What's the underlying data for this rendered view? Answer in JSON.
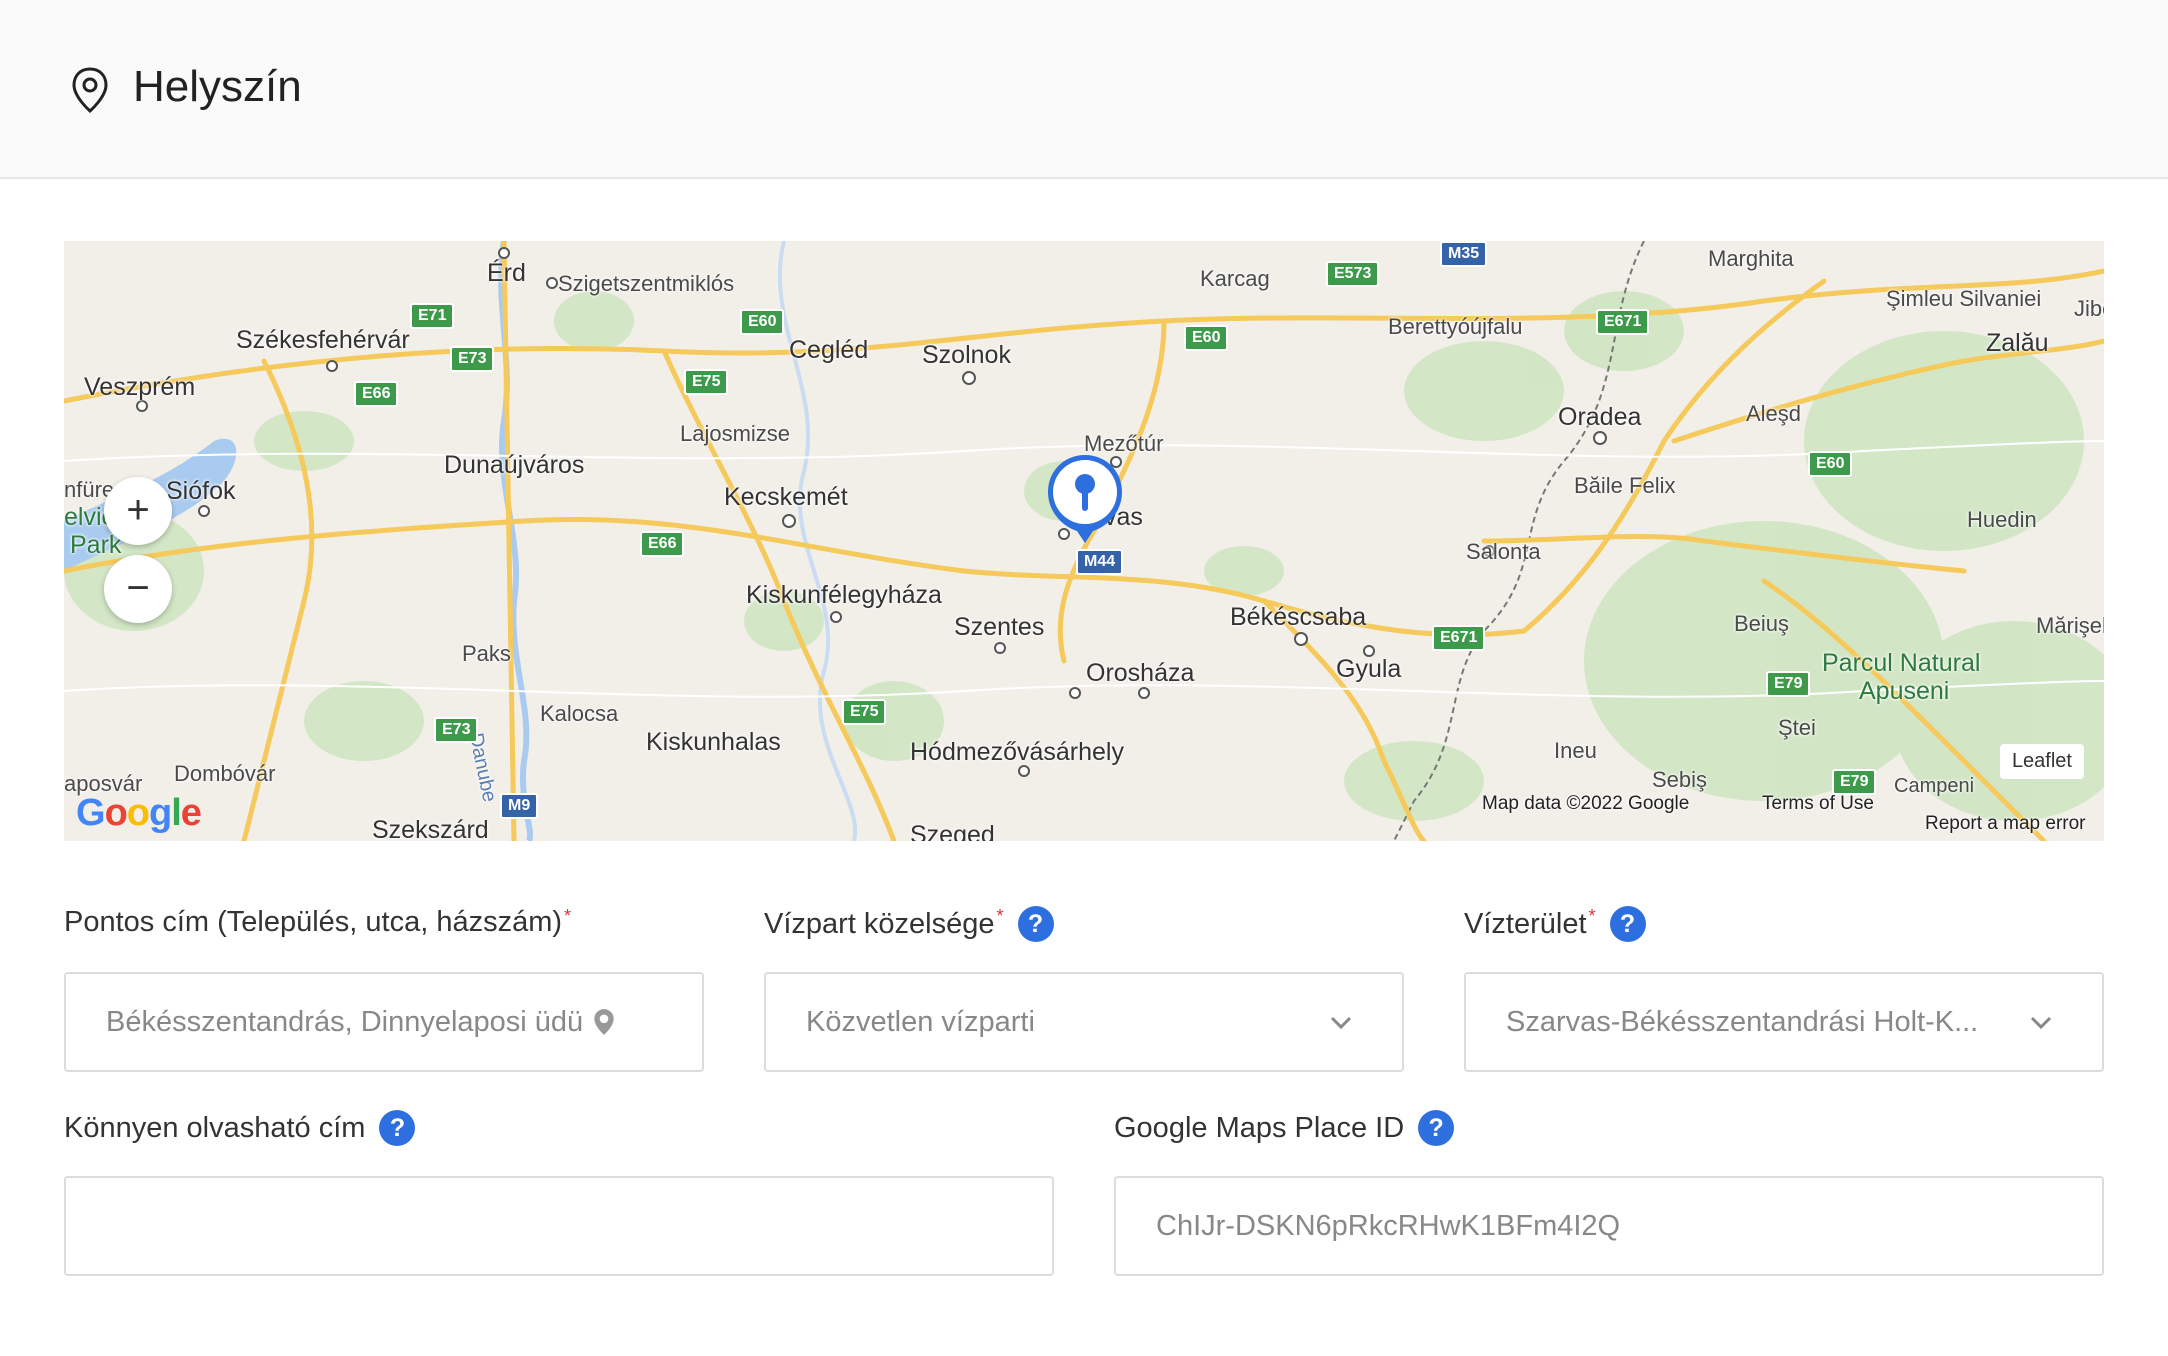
{
  "header": {
    "title": "Helyszín",
    "icon": "map-pin-icon"
  },
  "map": {
    "cities": [
      {
        "name": "Érd"
      },
      {
        "name": "Szigetszentmiklós"
      },
      {
        "name": "Karcag"
      },
      {
        "name": "Marghita"
      },
      {
        "name": "Székesfehérvár"
      },
      {
        "name": "Cegléd"
      },
      {
        "name": "Szolnok"
      },
      {
        "name": "Berettyóújfalu"
      },
      {
        "name": "Şimleu Silvaniei"
      },
      {
        "name": "Zalău"
      },
      {
        "name": "Jibo"
      },
      {
        "name": "Veszprém"
      },
      {
        "name": "Oradea"
      },
      {
        "name": "Aleşd"
      },
      {
        "name": "Lajosmizse"
      },
      {
        "name": "Mezőtúr"
      },
      {
        "name": "Dunaújváros"
      },
      {
        "name": "Băile Felix"
      },
      {
        "name": "Siófok"
      },
      {
        "name": "Kecskemét"
      },
      {
        "name": "Huedin"
      },
      {
        "name": "Salonta"
      },
      {
        "name": "Kiskunfélegyháza"
      },
      {
        "name": "Békéscsaba"
      },
      {
        "name": "Beiuş"
      },
      {
        "name": "Mărişel"
      },
      {
        "name": "Szentes"
      },
      {
        "name": "Paks"
      },
      {
        "name": "Gyula"
      },
      {
        "name": "Orosháza"
      },
      {
        "name": "Kalocsa"
      },
      {
        "name": "Kiskunhalas"
      },
      {
        "name": "Ştei"
      },
      {
        "name": "Hódmezővásárhely"
      },
      {
        "name": "Ineu"
      },
      {
        "name": "Sebiş"
      },
      {
        "name": "Dombóvár"
      },
      {
        "name": "aposvár"
      },
      {
        "name": "Campeni"
      },
      {
        "name": "Szekszárd"
      },
      {
        "name": "Szeged"
      },
      {
        "name": "nfüre"
      },
      {
        "name": "elvic"
      },
      {
        "name": "Park"
      },
      {
        "name": "vas"
      }
    ],
    "park_label_1": "Parcul Natural",
    "park_label_2": "Apuseni",
    "river_label": "Danube",
    "roads": [
      "E71",
      "E73",
      "E66",
      "E60",
      "E75",
      "E573",
      "M35",
      "E60",
      "E671",
      "E66",
      "E60",
      "E671",
      "E79",
      "E75",
      "E73",
      "M9",
      "E79",
      "M44"
    ],
    "zoom_in": "+",
    "zoom_out": "−",
    "attribution": "Map data ©2022 Google",
    "terms": "Terms of Use",
    "report": "Report a map error",
    "leaflet": "Leaflet",
    "google": "Google"
  },
  "form": {
    "address": {
      "label": "Pontos cím (Település, utca, házszám)",
      "required": "*",
      "value": "Békésszentandrás, Dinnyelaposi üdü"
    },
    "waterfront": {
      "label": "Vízpart közelsége",
      "required": "*",
      "help": "?",
      "value": "Közvetlen vízparti"
    },
    "water_area": {
      "label": "Vízterület",
      "required": "*",
      "help": "?",
      "value": "Szarvas-Békésszentandrási Holt-K..."
    },
    "readable_address": {
      "label": "Könnyen olvasható cím",
      "help": "?",
      "value": ""
    },
    "place_id": {
      "label": "Google Maps Place ID",
      "help": "?",
      "value": "ChIJr-DSKN6pRkcRHwK1BFm4I2Q"
    }
  },
  "colors": {
    "accent": "#2e6fe0",
    "road": "#f5c95a",
    "forest": "#cde8c4",
    "water": "#aacbf0"
  }
}
